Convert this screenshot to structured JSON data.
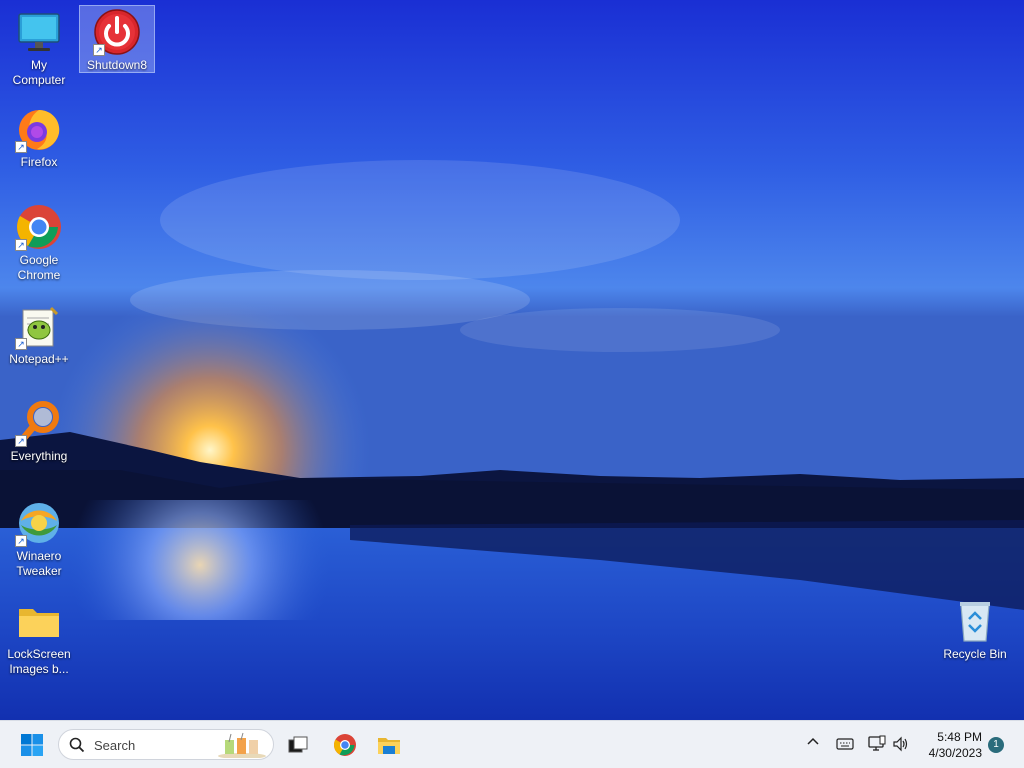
{
  "desktop": {
    "icons": [
      {
        "label": "My Computer",
        "icon": "monitor-icon"
      },
      {
        "label": "Shutdown8",
        "icon": "power-icon"
      },
      {
        "label": "Firefox",
        "icon": "firefox-icon"
      },
      {
        "label": "Google Chrome",
        "icon": "chrome-icon"
      },
      {
        "label": "Notepad++",
        "icon": "notepad-plus-plus-icon"
      },
      {
        "label": "Everything",
        "icon": "magnifier-icon"
      },
      {
        "label": "Winaero Tweaker",
        "icon": "winaero-icon"
      },
      {
        "label": "LockScreen Images b...",
        "icon": "folder-icon"
      },
      {
        "label": "Recycle Bin",
        "icon": "recycle-bin-icon"
      }
    ],
    "selected_icon": "Shutdown8"
  },
  "taskbar": {
    "search_placeholder": "Search",
    "pinned": [
      "task-view-icon",
      "chrome-icon",
      "file-explorer-icon"
    ],
    "clock_time": "5:48 PM",
    "clock_date": "4/30/2023",
    "notification_count": "1"
  },
  "colors": {
    "taskbar_bg": "#eef1f6",
    "accent": "#0067c0"
  }
}
